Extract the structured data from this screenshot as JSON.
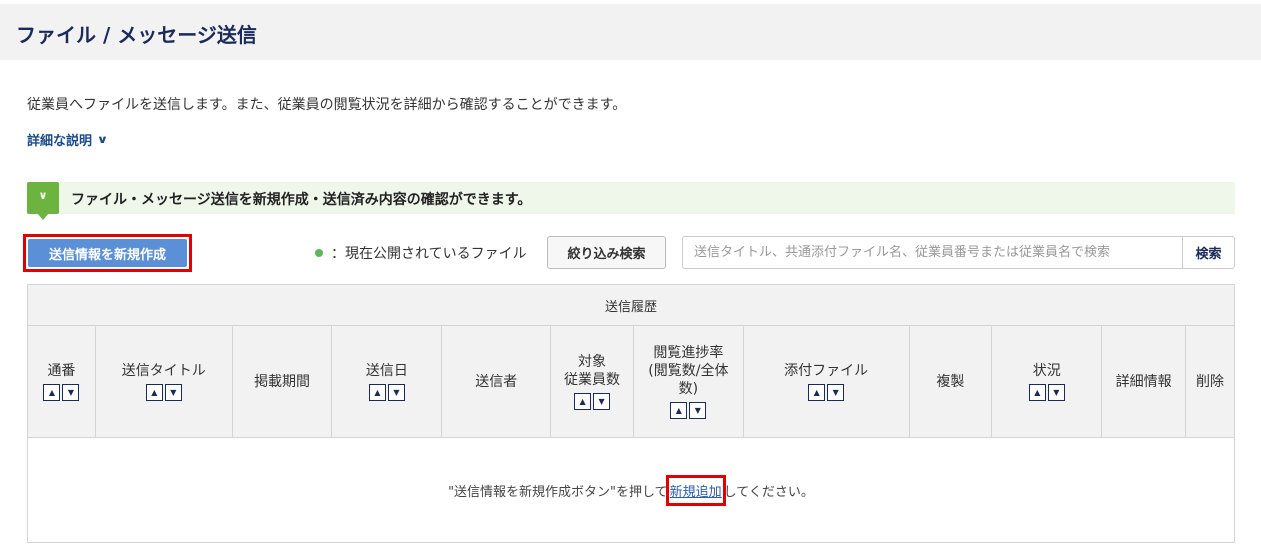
{
  "header": {
    "title": "ファイル / メッセージ送信"
  },
  "description": "従業員へファイルを送信します。また、従業員の閲覧状況を詳細から確認することができます。",
  "detail_link": {
    "label": "詳細な説明",
    "icon": "chevron-down-icon"
  },
  "banner": {
    "text": "ファイル・メッセージ送信を新規作成・送信済み内容の確認ができます。",
    "icon": "chevron-down-icon",
    "color": "#6cb33f"
  },
  "toolbar": {
    "new_button": "送信情報を新規作成",
    "legend_text": "：現在公開されているファイル",
    "filter_button": "絞り込み検索",
    "search_placeholder": "送信タイトル、共通添付ファイル名、従業員番号または従業員名で検索",
    "search_button": "検索"
  },
  "table": {
    "caption": "送信履歴",
    "columns": [
      {
        "label": "通番",
        "sortable": true
      },
      {
        "label": "送信タイトル",
        "sortable": true
      },
      {
        "label": "掲載期間",
        "sortable": false
      },
      {
        "label": "送信日",
        "sortable": true
      },
      {
        "label": "送信者",
        "sortable": false
      },
      {
        "label": "対象\n従業員数",
        "sortable": true
      },
      {
        "label": "閲覧進捗率\n(閲覧数/全体\n数)",
        "sortable": true
      },
      {
        "label": "添付ファイル",
        "sortable": true
      },
      {
        "label": "複製",
        "sortable": false
      },
      {
        "label": "状況",
        "sortable": true
      },
      {
        "label": "詳細情報",
        "sortable": false
      },
      {
        "label": "削除",
        "sortable": false
      }
    ],
    "empty": {
      "before": "\"送信情報を新規作成ボタン\"を押して",
      "link": "新規追加",
      "after": "してください。"
    }
  },
  "colors": {
    "primary_button": "#5b8fd6",
    "highlight": "#e00000",
    "active_dot": "#5cb85c"
  }
}
